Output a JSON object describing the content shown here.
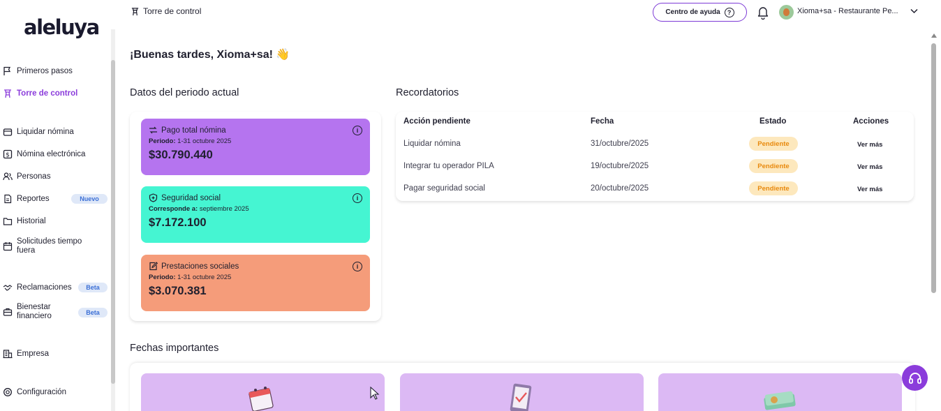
{
  "brand": {
    "logo_text": "aleluya"
  },
  "sidebar": {
    "items": [
      {
        "label": "Primeros pasos",
        "icon": "flag-icon"
      },
      {
        "label": "Torre de control",
        "icon": "tower-icon",
        "active": true
      },
      {
        "label": "Liquidar nómina",
        "icon": "wallet-icon"
      },
      {
        "label": "Nómina electrónica",
        "icon": "dollar-icon"
      },
      {
        "label": "Personas",
        "icon": "people-icon"
      },
      {
        "label": "Reportes",
        "icon": "report-icon",
        "badge": "Nuevo"
      },
      {
        "label": "Historial",
        "icon": "folder-icon"
      },
      {
        "label": "Solicitudes tiempo fuera",
        "icon": "calendar-icon"
      },
      {
        "label": "Reclamaciones",
        "icon": "handshake-icon",
        "badge": "Beta"
      },
      {
        "label": "Bienestar financiero",
        "icon": "briefcase-icon",
        "badge": "Beta"
      },
      {
        "label": "Empresa",
        "icon": "building-icon"
      },
      {
        "label": "Configuración",
        "icon": "gear-icon"
      }
    ]
  },
  "topbar": {
    "page_title": "Torre de control",
    "help_label": "Centro de ayuda",
    "user_name": "Xioma+sa - Restaurante Pe..."
  },
  "main": {
    "greeting": "¡Buenas tardes, Xioma+sa! 👋",
    "period_title": "Datos del periodo actual",
    "cards": [
      {
        "title": "Pago total nómina",
        "sub_label": "Periodo:",
        "sub_value": "1-31 octubre 2025",
        "amount": "$30.790.440",
        "color": "#b574ef"
      },
      {
        "title": "Seguridad social",
        "sub_label": "Corresponde a:",
        "sub_value": "septiembre 2025",
        "amount": "$7.172.100",
        "color": "#45f5d2"
      },
      {
        "title": "Prestaciones sociales",
        "sub_label": "Periodo:",
        "sub_value": "1-31 octubre 2025",
        "amount": "$3.070.381",
        "color": "#f59c7a"
      }
    ],
    "reminders_title": "Recordatorios",
    "reminders": {
      "headers": [
        "Acción pendiente",
        "Fecha",
        "Estado",
        "Acciones"
      ],
      "rows": [
        {
          "action": "Liquidar nómina",
          "date": "31/octubre/2025",
          "status": "Pendiente",
          "link": "Ver más"
        },
        {
          "action": "Integrar tu operador PILA",
          "date": "19/octubre/2025",
          "status": "Pendiente",
          "link": "Ver más"
        },
        {
          "action": "Pagar seguridad social",
          "date": "20/octubre/2025",
          "status": "Pendiente",
          "link": "Ver más"
        }
      ]
    },
    "dates_title": "Fechas importantes"
  },
  "colors": {
    "accent": "#8b3cdb",
    "pending_bg": "#fde8bd",
    "pending_text": "#e8890d",
    "date_card_bg": "#dcb9f4"
  }
}
